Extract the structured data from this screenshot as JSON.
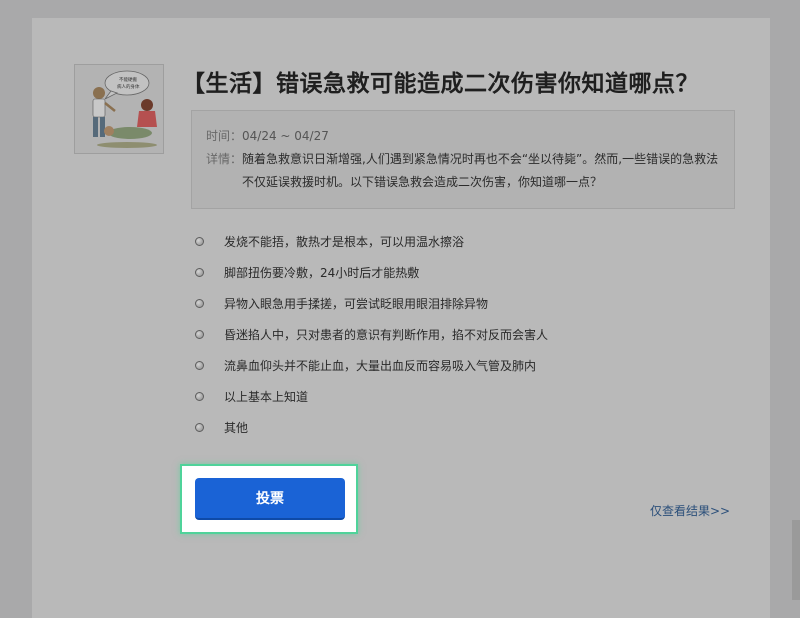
{
  "poll": {
    "title": "【生活】错误急救可能造成二次伤害你知道哪点？",
    "time_label": "时间：",
    "time_value": "04/24 ~ 04/27",
    "detail_label": "详情：",
    "detail_text": "随着急救意识日渐增强,人们遇到紧急情况时再也不会“坐以待毙”。然而,一些错误的急救法不仅延误救援时机。以下错误急救会造成二次伤害，你知道哪一点？",
    "thumbnail_icon": "first-aid-illustration",
    "thumbnail_caption": "不能硬搬病人的身体",
    "options": [
      "发烧不能捂，散热才是根本，可以用温水擦浴",
      "脚部扭伤要冷敷，24小时后才能热敷",
      "异物入眼急用手揉搓，可尝试眨眼用眼泪排除异物",
      "昏迷掐人中，只对患者的意识有判断作用，掐不对反而会害人",
      "流鼻血仰头并不能止血，大量出血反而容易吸入气管及肺内",
      "以上基本上知道",
      "其他"
    ],
    "vote_label": "投票",
    "results_link": "仅查看结果>>"
  },
  "colors": {
    "overlay": "#a9a9aa",
    "vote_button": "#1a63d6",
    "highlight_border": "#4fd39a",
    "link": "#2b4f7a"
  }
}
